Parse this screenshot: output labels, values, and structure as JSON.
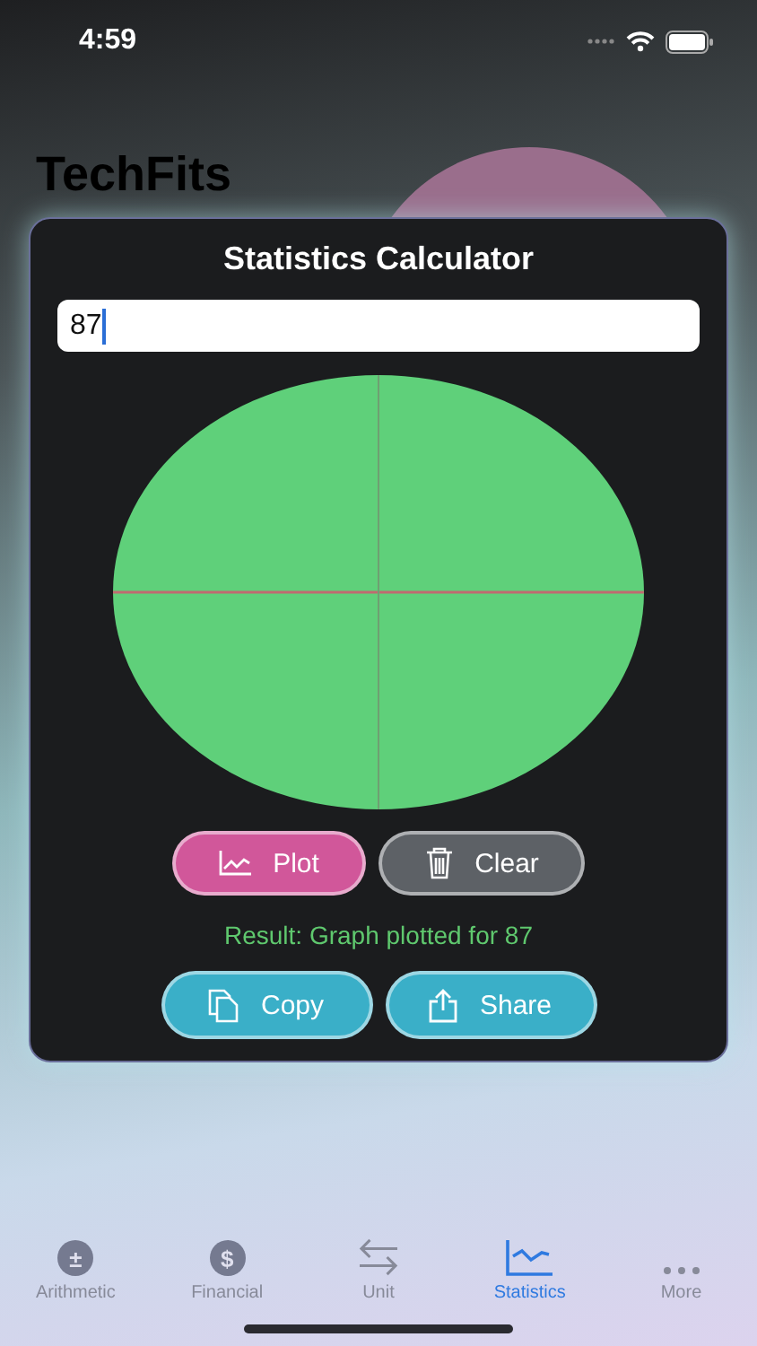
{
  "status_bar": {
    "time": "4:59"
  },
  "app_title": "TechFits",
  "card": {
    "title": "Statistics Calculator",
    "input": {
      "value": "87"
    },
    "buttons": [
      {
        "label": "Plot",
        "kind": "plot"
      },
      {
        "label": "Clear",
        "kind": "clear"
      }
    ],
    "result": "Result: Graph plotted for 87",
    "actions": [
      {
        "label": "Copy",
        "kind": "copy"
      },
      {
        "label": "Share",
        "kind": "share"
      }
    ]
  },
  "tab_bar": [
    {
      "label": "Arithmetic",
      "kind": "arithmetic",
      "glyph": "±",
      "selected": false
    },
    {
      "label": "Financial",
      "kind": "financial",
      "glyph": "$",
      "selected": false
    },
    {
      "label": "Unit",
      "kind": "unit",
      "selected": false
    },
    {
      "label": "Statistics",
      "kind": "statistics",
      "selected": true
    },
    {
      "label": "More",
      "kind": "more",
      "selected": false
    }
  ]
}
